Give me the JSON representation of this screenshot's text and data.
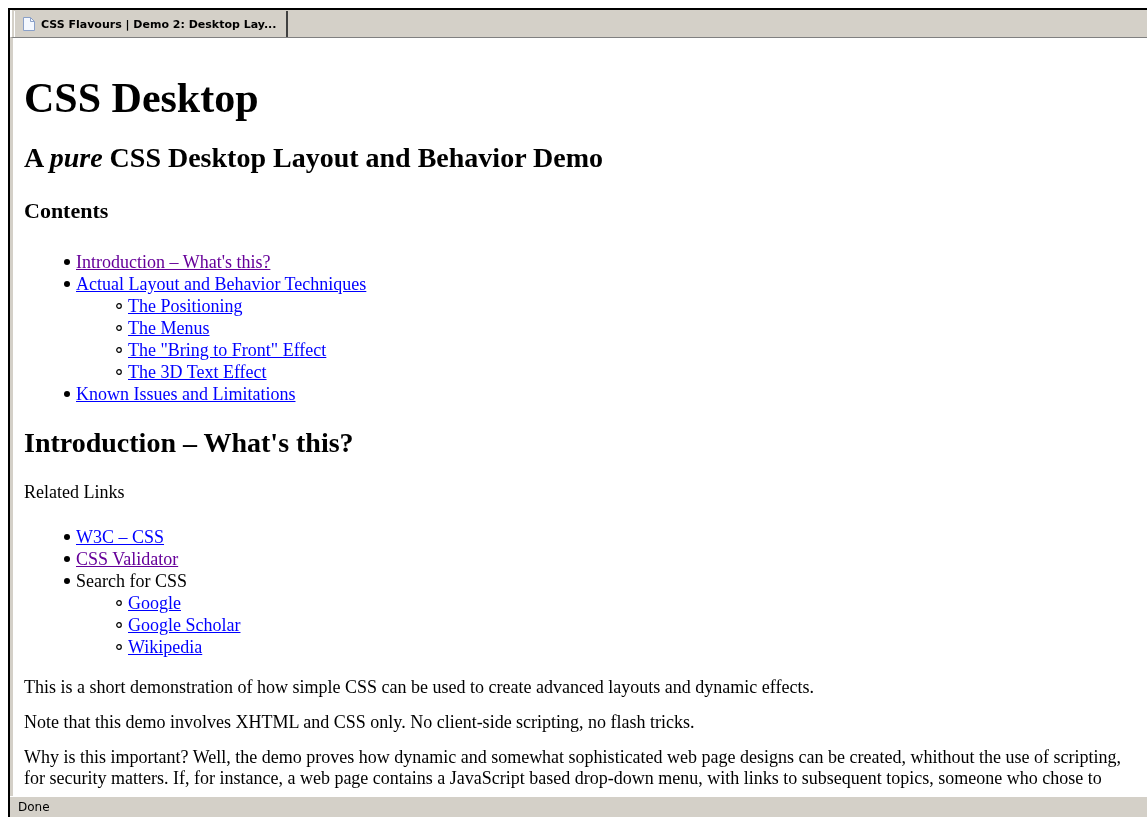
{
  "tab": {
    "title": "CSS Flavours | Demo 2: Desktop Lay...",
    "selected": true
  },
  "page": {
    "title": "CSS Desktop",
    "subtitle": "A *pure* CSS Desktop Layout and Behavior Demo",
    "contents_heading": "Contents",
    "contents": [
      {
        "kind": "link",
        "label": "Introduction – What's this?",
        "visited": true
      },
      {
        "kind": "link",
        "label": "Actual Layout and Behavior Techniques",
        "visited": false,
        "children": [
          {
            "kind": "link",
            "label": "The Positioning",
            "visited": false
          },
          {
            "kind": "link",
            "label": "The Menus",
            "visited": false
          },
          {
            "kind": "link",
            "label": "The \"Bring to Front\" Effect",
            "visited": false
          },
          {
            "kind": "link",
            "label": "The 3D Text Effect",
            "visited": false
          }
        ]
      },
      {
        "kind": "link",
        "label": "Known Issues and Limitations",
        "visited": false
      }
    ],
    "section_heading": "Introduction – What's this?",
    "related_label": "Related Links",
    "related": [
      {
        "kind": "link",
        "label": "W3C – CSS",
        "visited": false
      },
      {
        "kind": "link",
        "label": "CSS Validator",
        "visited": true
      },
      {
        "kind": "text",
        "label": "Search for CSS",
        "children": [
          {
            "kind": "link",
            "label": "Google",
            "visited": false
          },
          {
            "kind": "link",
            "label": "Google Scholar",
            "visited": false
          },
          {
            "kind": "link",
            "label": "Wikipedia",
            "visited": false
          }
        ]
      }
    ],
    "paragraphs": [
      [
        "This is a short demonstration of how simple CSS can be used to create advanced layouts and dynamic effects."
      ],
      [
        "Note that this demo involves XHTML and CSS only. No client-side scripting, no flash tricks."
      ],
      [
        "Why is this important? Well, the demo proves how dynamic and somewhat sophisticated web page designs can be created, whithout the use of scripting,",
        "for security matters. If, for instance, a web page contains a JavaScript based drop-down menu, with links to subsequent topics, someone who chose to"
      ]
    ]
  },
  "status_bar": {
    "text": "Done"
  }
}
